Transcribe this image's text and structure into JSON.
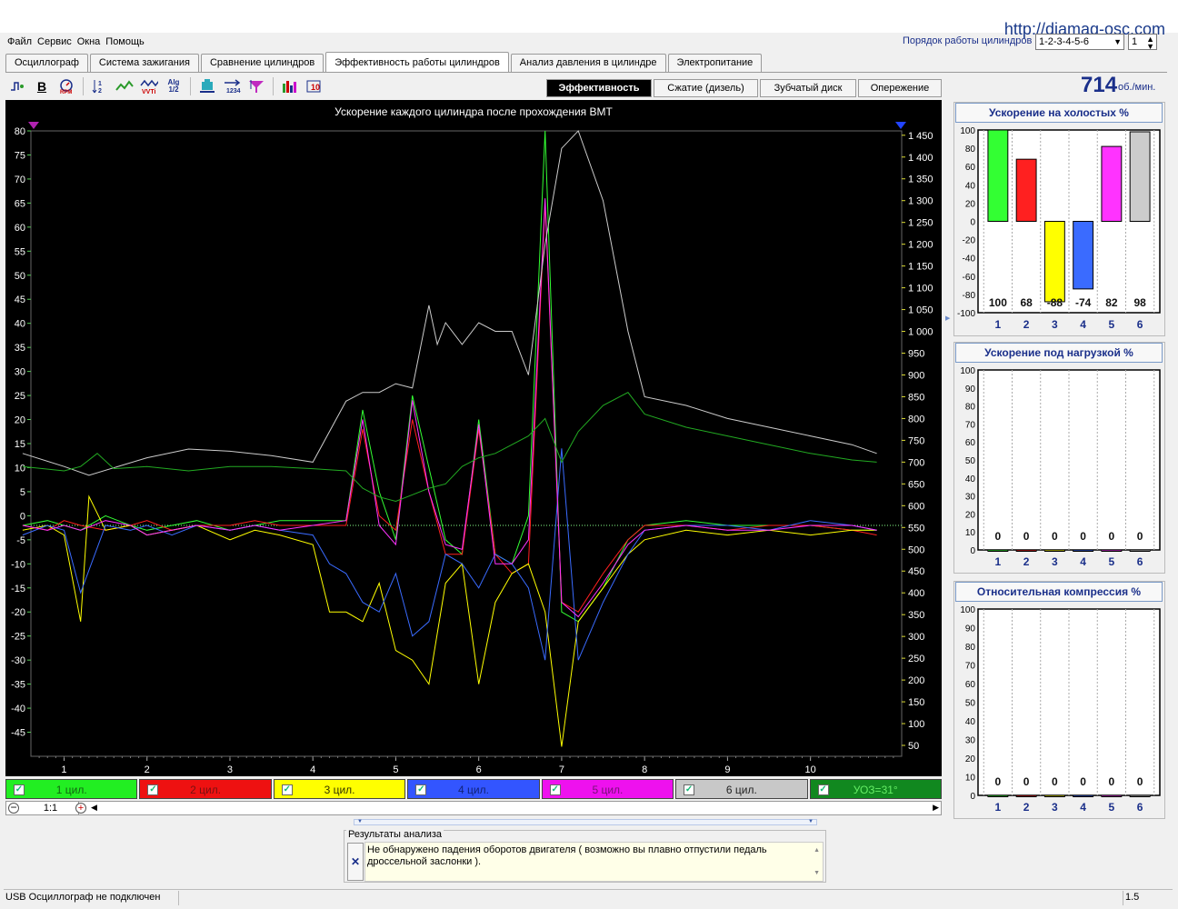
{
  "window": {
    "url": "http://diamag-osc.com"
  },
  "menu": [
    "Файл",
    "Сервис",
    "Окна",
    "Помощь"
  ],
  "cyl_order": {
    "label": "Порядок работы цилиндров",
    "value": "1-2-3-4-5-6",
    "second": "1"
  },
  "tabs": [
    "Осциллограф",
    "Система зажигания",
    "Сравнение цилиндров",
    "Эффективность работы цилиндров",
    "Анализ давления в цилиндре",
    "Электропитание"
  ],
  "active_tab": 3,
  "subtabs": [
    "Эффективность",
    "Сжатие (дизель)",
    "Зубчатый диск",
    "Опережение"
  ],
  "rpm": {
    "value": "714",
    "unit": "об./мин."
  },
  "toolbar_labels": {
    "alg": "Alg",
    "half": "1/2"
  },
  "chart_data": {
    "type": "line",
    "title": "Ускорение каждого цилиндра после прохождения ВМТ",
    "x_ticks": [
      "1",
      "2",
      "3",
      "4",
      "5",
      "6",
      "7",
      "8",
      "9",
      "10"
    ],
    "xlim": [
      0.6,
      11.1
    ],
    "y_left": {
      "ticks": [
        "80",
        "75",
        "70",
        "65",
        "60",
        "55",
        "50",
        "45",
        "40",
        "35",
        "30",
        "25",
        "20",
        "15",
        "10",
        "5",
        "0",
        "-5",
        "-10",
        "-15",
        "-20",
        "-25",
        "-30",
        "-35",
        "-40",
        "-45"
      ],
      "ylim": [
        -50,
        80
      ]
    },
    "y_right": {
      "ticks": [
        "1 450",
        "1 400",
        "1 350",
        "1 300",
        "1 250",
        "1 200",
        "1 150",
        "1 100",
        "1 050",
        "1 000",
        "950",
        "900",
        "850",
        "800",
        "750",
        "700",
        "650",
        "600",
        "550",
        "500",
        "450",
        "400",
        "350",
        "300",
        "250",
        "200",
        "150",
        "100",
        "50"
      ],
      "ylim": [
        25,
        1460
      ]
    },
    "series": [
      {
        "name": "1 цил.",
        "color": "#33ff33",
        "axis": "left",
        "x": [
          0.5,
          0.8,
          1.0,
          1.2,
          1.5,
          1.8,
          2.0,
          2.3,
          2.6,
          3.0,
          3.3,
          3.6,
          4.0,
          4.4,
          4.6,
          4.8,
          5.0,
          5.2,
          5.4,
          5.6,
          5.8,
          6.0,
          6.2,
          6.4,
          6.6,
          6.8,
          7.0,
          7.2,
          7.5,
          7.8,
          8.0,
          8.5,
          9.0,
          9.5,
          10.0,
          10.5,
          10.8
        ],
        "y": [
          -2,
          -1,
          -2,
          -3,
          0,
          -2,
          -3,
          -2,
          -1,
          -3,
          -2,
          -1,
          -1,
          -1,
          22,
          5,
          -5,
          25,
          10,
          -5,
          -8,
          20,
          -8,
          -10,
          0,
          80,
          -20,
          -22,
          -15,
          -5,
          -2,
          -1,
          -2,
          -2,
          -2,
          -3,
          -3
        ]
      },
      {
        "name": "2 цил.",
        "color": "#ff2020",
        "axis": "left",
        "x": [
          0.5,
          0.8,
          1.0,
          1.2,
          1.5,
          1.8,
          2.0,
          2.3,
          2.6,
          3.0,
          3.3,
          3.6,
          4.0,
          4.4,
          4.6,
          4.8,
          5.0,
          5.2,
          5.4,
          5.6,
          5.8,
          6.0,
          6.2,
          6.4,
          6.6,
          6.8,
          7.0,
          7.2,
          7.5,
          7.8,
          8.0,
          8.5,
          9.0,
          9.5,
          10.0,
          10.5,
          10.8
        ],
        "y": [
          -2,
          -3,
          -1,
          -2,
          -3,
          -2,
          -1,
          -3,
          -2,
          -2,
          -1,
          -2,
          -2,
          -2,
          18,
          0,
          -3,
          20,
          5,
          -8,
          -8,
          18,
          -8,
          -12,
          -10,
          65,
          -18,
          -20,
          -12,
          -5,
          -2,
          -2,
          -3,
          -2,
          -2,
          -3,
          -4
        ]
      },
      {
        "name": "3 цил.",
        "color": "#ffff00",
        "axis": "left",
        "x": [
          0.5,
          0.8,
          1.0,
          1.2,
          1.3,
          1.5,
          1.8,
          2.0,
          2.3,
          2.6,
          3.0,
          3.3,
          3.6,
          4.0,
          4.2,
          4.4,
          4.6,
          4.8,
          5.0,
          5.2,
          5.4,
          5.6,
          5.8,
          6.0,
          6.2,
          6.4,
          6.6,
          6.8,
          7.0,
          7.2,
          7.5,
          7.8,
          8.0,
          8.5,
          9.0,
          9.5,
          10.0,
          10.5,
          10.8
        ],
        "y": [
          -3,
          -2,
          -4,
          -22,
          4,
          -3,
          -2,
          -4,
          -3,
          -2,
          -5,
          -3,
          -4,
          -6,
          -20,
          -20,
          -22,
          -14,
          -28,
          -30,
          -35,
          -14,
          -10,
          -35,
          -18,
          -12,
          -10,
          -20,
          -48,
          -22,
          -15,
          -8,
          -5,
          -3,
          -4,
          -3,
          -4,
          -3,
          -3
        ]
      },
      {
        "name": "4 цил.",
        "color": "#3a6bff",
        "axis": "left",
        "x": [
          0.5,
          0.8,
          1.0,
          1.2,
          1.5,
          1.8,
          2.0,
          2.3,
          2.6,
          3.0,
          3.3,
          3.6,
          4.0,
          4.2,
          4.4,
          4.6,
          4.8,
          5.0,
          5.2,
          5.4,
          5.6,
          5.8,
          6.0,
          6.2,
          6.4,
          6.6,
          6.8,
          7.0,
          7.2,
          7.5,
          7.8,
          8.0,
          8.5,
          9.0,
          9.5,
          10.0,
          10.5,
          10.8
        ],
        "y": [
          -4,
          -2,
          -3,
          -16,
          -2,
          -3,
          -2,
          -4,
          -2,
          -3,
          -2,
          -3,
          -4,
          -10,
          -12,
          -18,
          -20,
          -12,
          -25,
          -22,
          -8,
          -10,
          -15,
          -8,
          -10,
          -15,
          -30,
          14,
          -30,
          -18,
          -8,
          -3,
          -2,
          -2,
          -3,
          -1,
          -2,
          -3
        ]
      },
      {
        "name": "5 цил.",
        "color": "#ff33ff",
        "axis": "left",
        "x": [
          0.5,
          0.8,
          1.0,
          1.2,
          1.5,
          1.8,
          2.0,
          2.3,
          2.6,
          3.0,
          3.3,
          3.6,
          4.0,
          4.4,
          4.6,
          4.8,
          5.0,
          5.2,
          5.4,
          5.6,
          5.8,
          6.0,
          6.2,
          6.4,
          6.6,
          6.8,
          7.0,
          7.2,
          7.5,
          7.8,
          8.0,
          8.5,
          9.0,
          9.5,
          10.0,
          10.5,
          10.8
        ],
        "y": [
          -2,
          -3,
          -2,
          -3,
          -1,
          -2,
          -4,
          -3,
          -2,
          -3,
          -2,
          -3,
          -2,
          -1,
          20,
          -2,
          -6,
          24,
          5,
          -6,
          -7,
          19,
          -10,
          -10,
          -5,
          66,
          -18,
          -21,
          -14,
          -6,
          -3,
          -2,
          -3,
          -3,
          -2,
          -2,
          -3
        ]
      },
      {
        "name": "6 цил.",
        "color": "#cccccc",
        "axis": "right",
        "x": [
          0.5,
          1.0,
          1.3,
          2.0,
          2.5,
          3.0,
          3.5,
          4.0,
          4.4,
          4.6,
          4.8,
          5.0,
          5.2,
          5.4,
          5.5,
          5.6,
          5.8,
          6.0,
          6.2,
          6.4,
          6.6,
          6.8,
          7.0,
          7.2,
          7.5,
          7.8,
          8.0,
          8.5,
          9.0,
          9.5,
          10.0,
          10.5,
          10.8
        ],
        "y": [
          720,
          690,
          670,
          710,
          730,
          725,
          715,
          700,
          840,
          860,
          860,
          880,
          870,
          1060,
          970,
          1020,
          970,
          1020,
          1000,
          1000,
          900,
          1200,
          1420,
          1460,
          1300,
          1000,
          850,
          830,
          800,
          780,
          760,
          740,
          720
        ]
      },
      {
        "name": "УОЗ=31°",
        "color": "#22aa22",
        "axis": "right",
        "x": [
          0.5,
          1.0,
          1.2,
          1.4,
          1.6,
          2.0,
          2.5,
          3.0,
          3.5,
          4.0,
          4.4,
          4.6,
          4.8,
          5.0,
          5.2,
          5.4,
          5.6,
          5.8,
          6.0,
          6.2,
          6.4,
          6.6,
          6.8,
          7.0,
          7.2,
          7.5,
          7.8,
          8.0,
          8.5,
          9.0,
          9.5,
          10.0,
          10.5,
          10.8
        ],
        "y": [
          690,
          680,
          690,
          720,
          685,
          690,
          680,
          690,
          690,
          685,
          680,
          640,
          620,
          610,
          625,
          640,
          650,
          690,
          710,
          720,
          740,
          760,
          800,
          700,
          770,
          830,
          860,
          810,
          780,
          760,
          740,
          720,
          705,
          700
        ]
      }
    ]
  },
  "right_panels": [
    {
      "title": "Ускорение на холостых %",
      "values": [
        100,
        68,
        -88,
        -74,
        82,
        98
      ],
      "labels": [
        "100",
        "68",
        "-88",
        "-74",
        "82",
        "98"
      ],
      "ylim": [
        -100,
        100
      ],
      "ticks": [
        "100",
        "80",
        "60",
        "40",
        "20",
        "0",
        "-20",
        "-40",
        "-60",
        "-80",
        "-100"
      ],
      "colors": [
        "#33ff33",
        "#ff2020",
        "#ffff00",
        "#3a6bff",
        "#ff33ff",
        "#cccccc"
      ],
      "x_labels": [
        "1",
        "2",
        "3",
        "4",
        "5",
        "6"
      ]
    },
    {
      "title": "Ускорение под нагрузкой %",
      "values": [
        0,
        0,
        0,
        0,
        0,
        0
      ],
      "labels": [
        "0",
        "0",
        "0",
        "0",
        "0",
        "0"
      ],
      "ylim": [
        0,
        100
      ],
      "ticks": [
        "100",
        "90",
        "80",
        "70",
        "60",
        "50",
        "40",
        "30",
        "20",
        "10",
        "0"
      ],
      "colors": [
        "#33ff33",
        "#ff2020",
        "#ffff00",
        "#3a6bff",
        "#ff33ff",
        "#cccccc"
      ],
      "x_labels": [
        "1",
        "2",
        "3",
        "4",
        "5",
        "6"
      ]
    },
    {
      "title": "Относительная компрессия %",
      "values": [
        0,
        0,
        0,
        0,
        0,
        0
      ],
      "labels": [
        "0",
        "0",
        "0",
        "0",
        "0",
        "0"
      ],
      "ylim": [
        0,
        100
      ],
      "ticks": [
        "100",
        "90",
        "80",
        "70",
        "60",
        "50",
        "40",
        "30",
        "20",
        "10",
        "0"
      ],
      "colors": [
        "#33ff33",
        "#ff2020",
        "#ffff00",
        "#3a6bff",
        "#ff33ff",
        "#cccccc"
      ],
      "x_labels": [
        "1",
        "2",
        "3",
        "4",
        "5",
        "6"
      ]
    }
  ],
  "legend": [
    {
      "label": "1 цил.",
      "bg": "#22ee22",
      "fg": "#116611"
    },
    {
      "label": "2 цил.",
      "bg": "#ee1111",
      "fg": "#771111"
    },
    {
      "label": "3 цил.",
      "bg": "#ffff00",
      "fg": "#333300"
    },
    {
      "label": "4 цил.",
      "bg": "#3355ff",
      "fg": "#112277"
    },
    {
      "label": "5 цил.",
      "bg": "#ee11ee",
      "fg": "#771177"
    },
    {
      "label": "6 цил.",
      "bg": "#c8c8c8",
      "fg": "#222222"
    },
    {
      "label": "УОЗ=31°",
      "bg": "#11881f",
      "fg": "#66ee66"
    }
  ],
  "zoom": "1:1",
  "results": {
    "title": "Результаты анализа",
    "text": "Не обнаружено падения оборотов двигателя ( возможно вы плавно отпустили педаль дроссельной заслонки )."
  },
  "status": {
    "text": "USB Осциллограф не подключен",
    "version": "1.5"
  }
}
